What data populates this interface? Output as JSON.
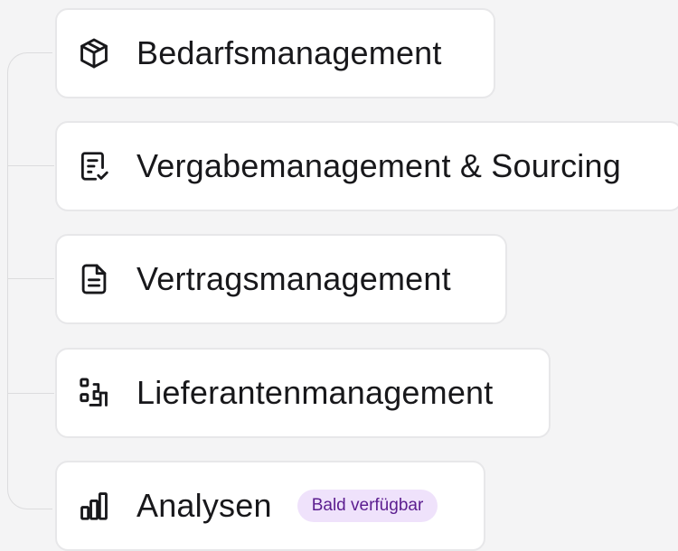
{
  "items": [
    {
      "label": "Bedarfsmanagement",
      "icon": "package-icon"
    },
    {
      "label": "Vergabemanagement & Sourcing",
      "icon": "receipt-check-icon"
    },
    {
      "label": "Vertragsmanagement",
      "icon": "file-text-icon"
    },
    {
      "label": "Lieferantenmanagement",
      "icon": "workflow-icon"
    },
    {
      "label": "Analysen",
      "icon": "bar-chart-icon",
      "badge": "Bald verfügbar"
    }
  ],
  "colors": {
    "background": "#f4f4f5",
    "card": "#ffffff",
    "text": "#18181b",
    "badge_bg": "#efe2fb",
    "badge_text": "#5b1d8f"
  }
}
